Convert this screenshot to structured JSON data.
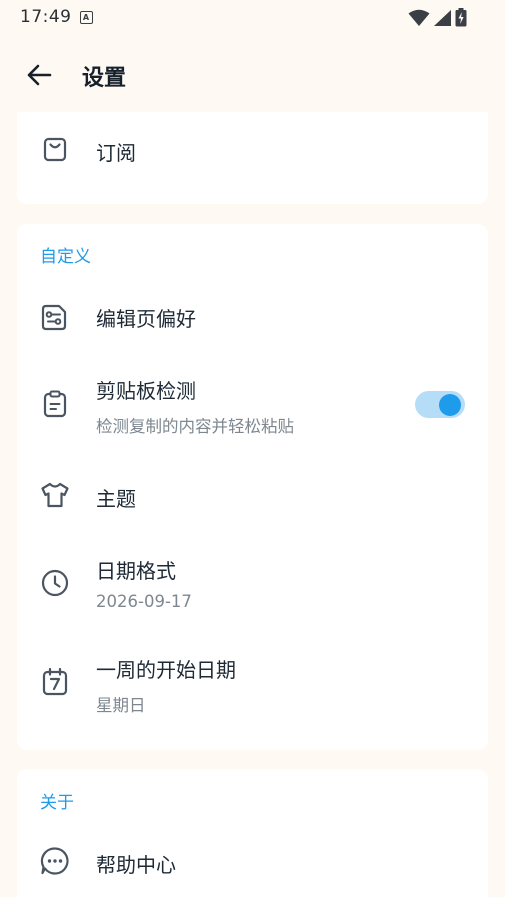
{
  "status_bar": {
    "time": "17:49",
    "notification_badge": "A",
    "icons": [
      "wifi-icon",
      "cellular-signal-icon",
      "battery-charging-icon"
    ]
  },
  "app_bar": {
    "back_icon": "arrow-left-icon",
    "title": "设置"
  },
  "sections": {
    "subscription": {
      "items": [
        {
          "icon": "shopping-bag-icon",
          "title": "订阅"
        }
      ]
    },
    "customize": {
      "header": "自定义",
      "items": [
        {
          "icon": "editor-settings-icon",
          "title": "编辑页偏好"
        },
        {
          "icon": "clipboard-icon",
          "title": "剪贴板检测",
          "subtitle": "检测复制的内容并轻松粘贴",
          "toggle_on": true
        },
        {
          "icon": "shirt-icon",
          "title": "主题"
        },
        {
          "icon": "clock-icon",
          "title": "日期格式",
          "subtitle": "2026-09-17"
        },
        {
          "icon": "calendar-7-icon",
          "title": "一周的开始日期",
          "subtitle": "星期日"
        }
      ]
    },
    "about": {
      "header": "关于",
      "items": [
        {
          "icon": "chat-bubble-icon",
          "title": "帮助中心"
        }
      ]
    }
  },
  "colors": {
    "accent": "#1E9BEA",
    "background": "#FEF9F3",
    "card": "#FFFFFF",
    "toggle_track": "#B5DDF8",
    "subtitle_text": "#7E8790"
  }
}
